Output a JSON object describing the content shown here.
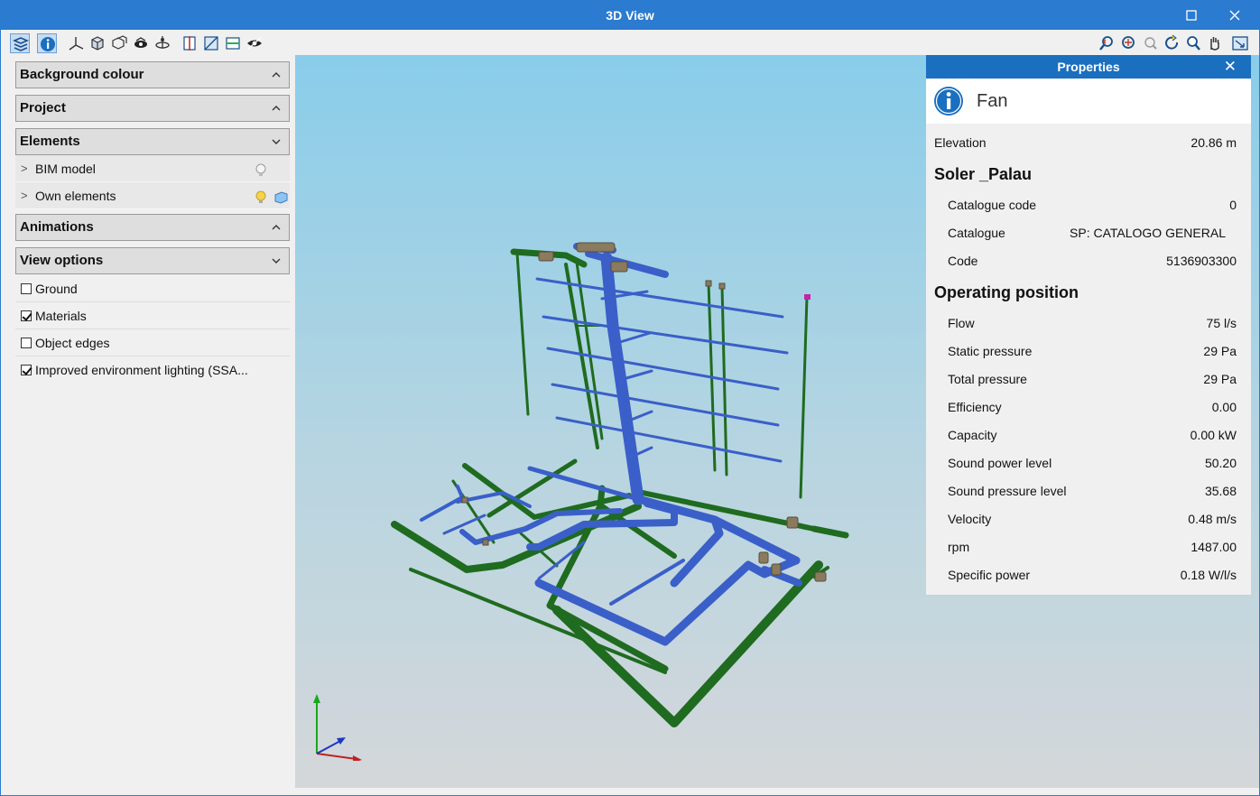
{
  "window": {
    "title": "3D View"
  },
  "left_panel": {
    "sections": {
      "background": "Background colour",
      "project": "Project",
      "elements": "Elements",
      "animations": "Animations",
      "view_options": "View options"
    },
    "elements_items": [
      "BIM model",
      "Own elements"
    ],
    "view_options": [
      {
        "label": "Ground",
        "checked": false
      },
      {
        "label": "Materials",
        "checked": true
      },
      {
        "label": "Object edges",
        "checked": false
      },
      {
        "label": "Improved environment lighting (SSA...",
        "checked": true
      }
    ]
  },
  "properties": {
    "header": "Properties",
    "close_glyph": "✕",
    "element_name": "Fan",
    "elevation": {
      "label": "Elevation",
      "value": "20.86 m"
    },
    "manufacturer": {
      "name": "Soler _Palau",
      "rows": [
        {
          "label": "Catalogue code",
          "value": "0"
        },
        {
          "label": "Catalogue",
          "value": "SP: CATALOGO GENERAL"
        },
        {
          "label": "Code",
          "value": "5136903300"
        }
      ]
    },
    "operating": {
      "name": "Operating position",
      "rows": [
        {
          "label": "Flow",
          "value": "75 l/s"
        },
        {
          "label": "Static pressure",
          "value": "29 Pa"
        },
        {
          "label": "Total pressure",
          "value": "29 Pa"
        },
        {
          "label": "Efficiency",
          "value": "0.00"
        },
        {
          "label": "Capacity",
          "value": "0.00 kW"
        },
        {
          "label": "Sound power level",
          "value": "50.20"
        },
        {
          "label": "Sound pressure level",
          "value": "35.68"
        },
        {
          "label": "Velocity",
          "value": "0.48 m/s"
        },
        {
          "label": "rpm",
          "value": "1487.00"
        },
        {
          "label": "Specific power",
          "value": "0.18 W/l/s"
        }
      ]
    }
  },
  "colors": {
    "titlebar": "#2b7bd0",
    "duct_blue": "#3a5fc8",
    "pipe_green": "#1f6b1f",
    "fitting": "#8a7a5e"
  }
}
